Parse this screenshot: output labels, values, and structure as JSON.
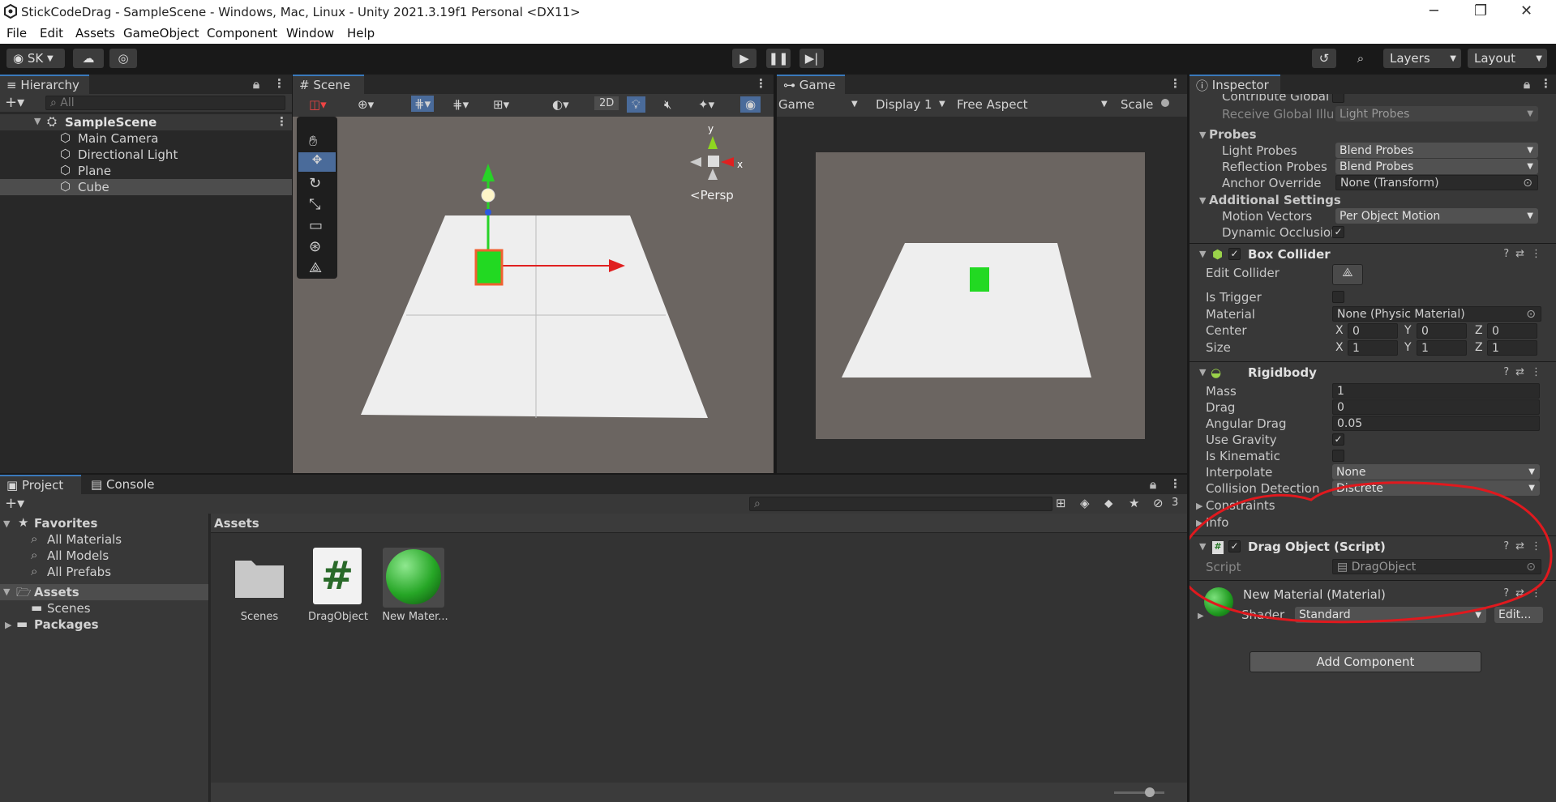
{
  "window": {
    "title": "StickCodeDrag - SampleScene - Windows, Mac, Linux - Unity 2021.3.19f1 Personal <DX11>",
    "controls": [
      "─",
      "❐",
      "✕"
    ]
  },
  "menu": [
    "File",
    "Edit",
    "Assets",
    "GameObject",
    "Component",
    "Window",
    "Help"
  ],
  "toolbar": {
    "account": "SK",
    "layers": "Layers",
    "layout": "Layout"
  },
  "hierarchy": {
    "tab": "Hierarchy",
    "search_placeholder": "All",
    "scene": "SampleScene",
    "items": [
      "Main Camera",
      "Directional Light",
      "Plane",
      "Cube"
    ]
  },
  "scene": {
    "tab": "Scene",
    "btn_2d": "2D",
    "persp": "Persp",
    "axis_x": "x",
    "axis_y": "y"
  },
  "game": {
    "tab": "Game",
    "mode": "Game",
    "display": "Display 1",
    "aspect": "Free Aspect",
    "scale": "Scale"
  },
  "inspector": {
    "tab": "Inspector",
    "rows_top": [
      {
        "label": "Contribute Global I"
      },
      {
        "label": "Receive Global Illu",
        "value": "Light Probes"
      }
    ],
    "probes_header": "Probes",
    "light_probes": {
      "label": "Light Probes",
      "value": "Blend Probes"
    },
    "reflection_probes": {
      "label": "Reflection Probes",
      "value": "Blend Probes"
    },
    "anchor_override": {
      "label": "Anchor Override",
      "value": "None (Transform)"
    },
    "additional_header": "Additional Settings",
    "motion_vectors": {
      "label": "Motion Vectors",
      "value": "Per Object Motion"
    },
    "dynamic_occlusion": {
      "label": "Dynamic Occlusioı"
    },
    "box_collider": {
      "name": "Box Collider",
      "edit_collider": "Edit Collider",
      "is_trigger": "Is Trigger",
      "material": {
        "label": "Material",
        "value": "None (Physic Material)"
      },
      "center": {
        "label": "Center",
        "x": "0",
        "y": "0",
        "z": "0"
      },
      "size": {
        "label": "Size",
        "x": "1",
        "y": "1",
        "z": "1"
      },
      "axis_x": "X",
      "axis_y": "Y",
      "axis_z": "Z"
    },
    "rigidbody": {
      "name": "Rigidbody",
      "mass": {
        "label": "Mass",
        "value": "1"
      },
      "drag": {
        "label": "Drag",
        "value": "0"
      },
      "angular_drag": {
        "label": "Angular Drag",
        "value": "0.05"
      },
      "use_gravity": "Use Gravity",
      "is_kinematic": "Is Kinematic",
      "interpolate": {
        "label": "Interpolate",
        "value": "None"
      },
      "collision_detection": {
        "label": "Collision Detection",
        "value": "Discrete"
      },
      "constraints": "Constraints",
      "info": "Info"
    },
    "drag_object": {
      "name": "Drag Object (Script)",
      "script_label": "Script",
      "script_value": "DragObject"
    },
    "material": {
      "name": "New Material (Material)",
      "shader_label": "Shader",
      "shader_value": "Standard",
      "edit": "Edit..."
    },
    "add_component": "Add Component"
  },
  "project": {
    "tab_project": "Project",
    "tab_console": "Console",
    "favorites": "Favorites",
    "fav_items": [
      "All Materials",
      "All Models",
      "All Prefabs"
    ],
    "assets": "Assets",
    "scenes": "Scenes",
    "packages": "Packages",
    "breadcrumb": "Assets",
    "hidden_count": "3",
    "files": [
      {
        "name": "Scenes",
        "icon": "folder-icon"
      },
      {
        "name": "DragObject",
        "icon": "csharp-script-icon"
      },
      {
        "name": "New Mater...",
        "icon": "material-sphere-icon"
      }
    ]
  },
  "colors": {
    "accent": "#3a79bb",
    "annotation": "#e0191e",
    "cube_green": "#22d922"
  }
}
